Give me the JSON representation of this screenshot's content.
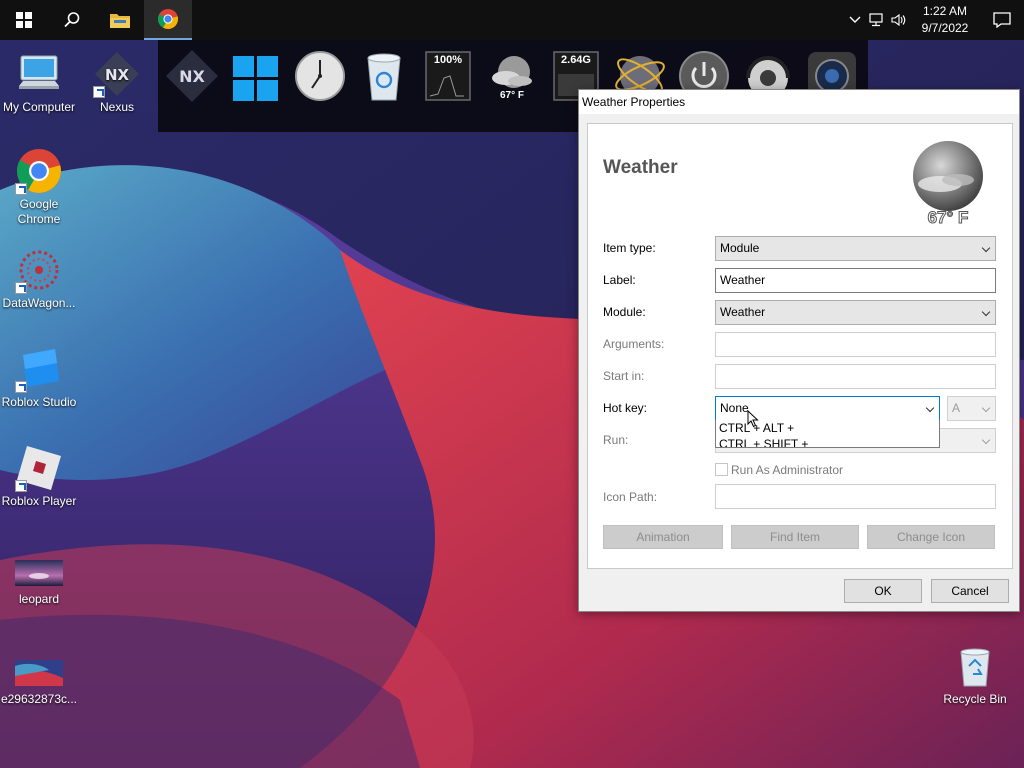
{
  "taskbar": {
    "time": "1:22 AM",
    "date": "9/7/2022"
  },
  "desktop": {
    "icons": [
      {
        "label": "My Computer"
      },
      {
        "label": "Nexus"
      },
      {
        "label": "Google Chrome"
      },
      {
        "label": "DataWagon..."
      },
      {
        "label": "Roblox Studio"
      },
      {
        "label": "Roblox Player"
      },
      {
        "label": "leopard"
      },
      {
        "label": "e29632873c..."
      },
      {
        "label": "Recycle Bin"
      }
    ]
  },
  "dock": {
    "cpu_meter": "100%",
    "weather_temp": "67° F",
    "ram_meter": "2.64G"
  },
  "dialog": {
    "title": "Weather Properties",
    "heading": "Weather",
    "badge_temp": "67° F",
    "labels": {
      "item_type": "Item type:",
      "label": "Label:",
      "module": "Module:",
      "arguments": "Arguments:",
      "start_in": "Start in:",
      "hot_key": "Hot key:",
      "run": "Run:",
      "run_as_admin": "Run As Administrator",
      "icon_path": "Icon Path:"
    },
    "values": {
      "item_type": "Module",
      "label": "Weather",
      "module": "Weather",
      "arguments": "",
      "start_in": "",
      "hot_key": "None",
      "hot_key_letter": "A",
      "icon_path": ""
    },
    "hotkey_options": [
      "CTRL + ALT +",
      "CTRL + SHIFT +"
    ],
    "buttons": {
      "animation": "Animation",
      "find_item": "Find Item",
      "change_icon": "Change Icon",
      "ok": "OK",
      "cancel": "Cancel"
    }
  }
}
